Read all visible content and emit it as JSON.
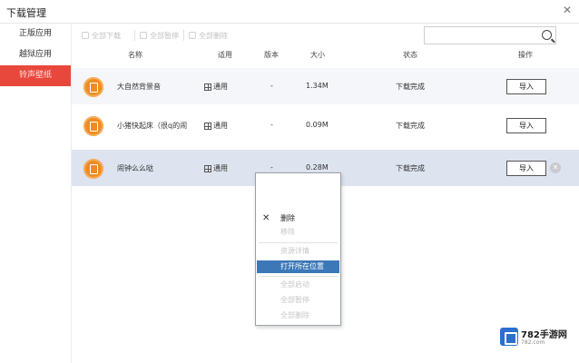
{
  "window": {
    "title": "下载管理",
    "close_glyph": "✕"
  },
  "sidebar": {
    "items": [
      {
        "label": "正版应用",
        "active": false
      },
      {
        "label": "越狱应用",
        "active": false
      },
      {
        "label": "铃声壁纸",
        "active": true
      }
    ]
  },
  "toolbar": {
    "buttons": [
      {
        "label": "全部下载"
      },
      {
        "label": "全部暂停"
      },
      {
        "label": "全部删除"
      }
    ],
    "search_placeholder": ""
  },
  "table": {
    "headers": {
      "name": "名称",
      "compat": "适用",
      "version": "版本",
      "size": "大小",
      "status": "状态",
      "action": "操作"
    },
    "rows": [
      {
        "name": "大自然背景音",
        "compat": "通用",
        "version": "-",
        "size": "1.34M",
        "status": "下载完成",
        "action": "导入"
      },
      {
        "name": "小猪快起床（很q的闹",
        "compat": "通用",
        "version": "-",
        "size": "0.09M",
        "status": "下载完成",
        "action": "导入"
      },
      {
        "name": "闹钟么么哒",
        "compat": "通用",
        "version": "-",
        "size": "0.28M",
        "status": "下载完成",
        "action": "导入"
      }
    ]
  },
  "context_menu": {
    "items": [
      {
        "label": "删除",
        "state": "enabled"
      },
      {
        "label": "移除",
        "state": "disabled"
      },
      {
        "label": "资源详情",
        "state": "disabled"
      },
      {
        "label": "打开所在位置",
        "state": "highlight"
      },
      {
        "label": "全部启动",
        "state": "disabled"
      },
      {
        "label": "全部暂停",
        "state": "disabled"
      },
      {
        "label": "全部删除",
        "state": "disabled"
      }
    ]
  },
  "watermark": {
    "text": "782手游网",
    "sub": "782.com"
  },
  "colors": {
    "sidebar_active": "#e8483c",
    "menu_highlight": "#3c78b8",
    "selected_row": "#dde4ef",
    "app_icon": "#f08b23"
  }
}
